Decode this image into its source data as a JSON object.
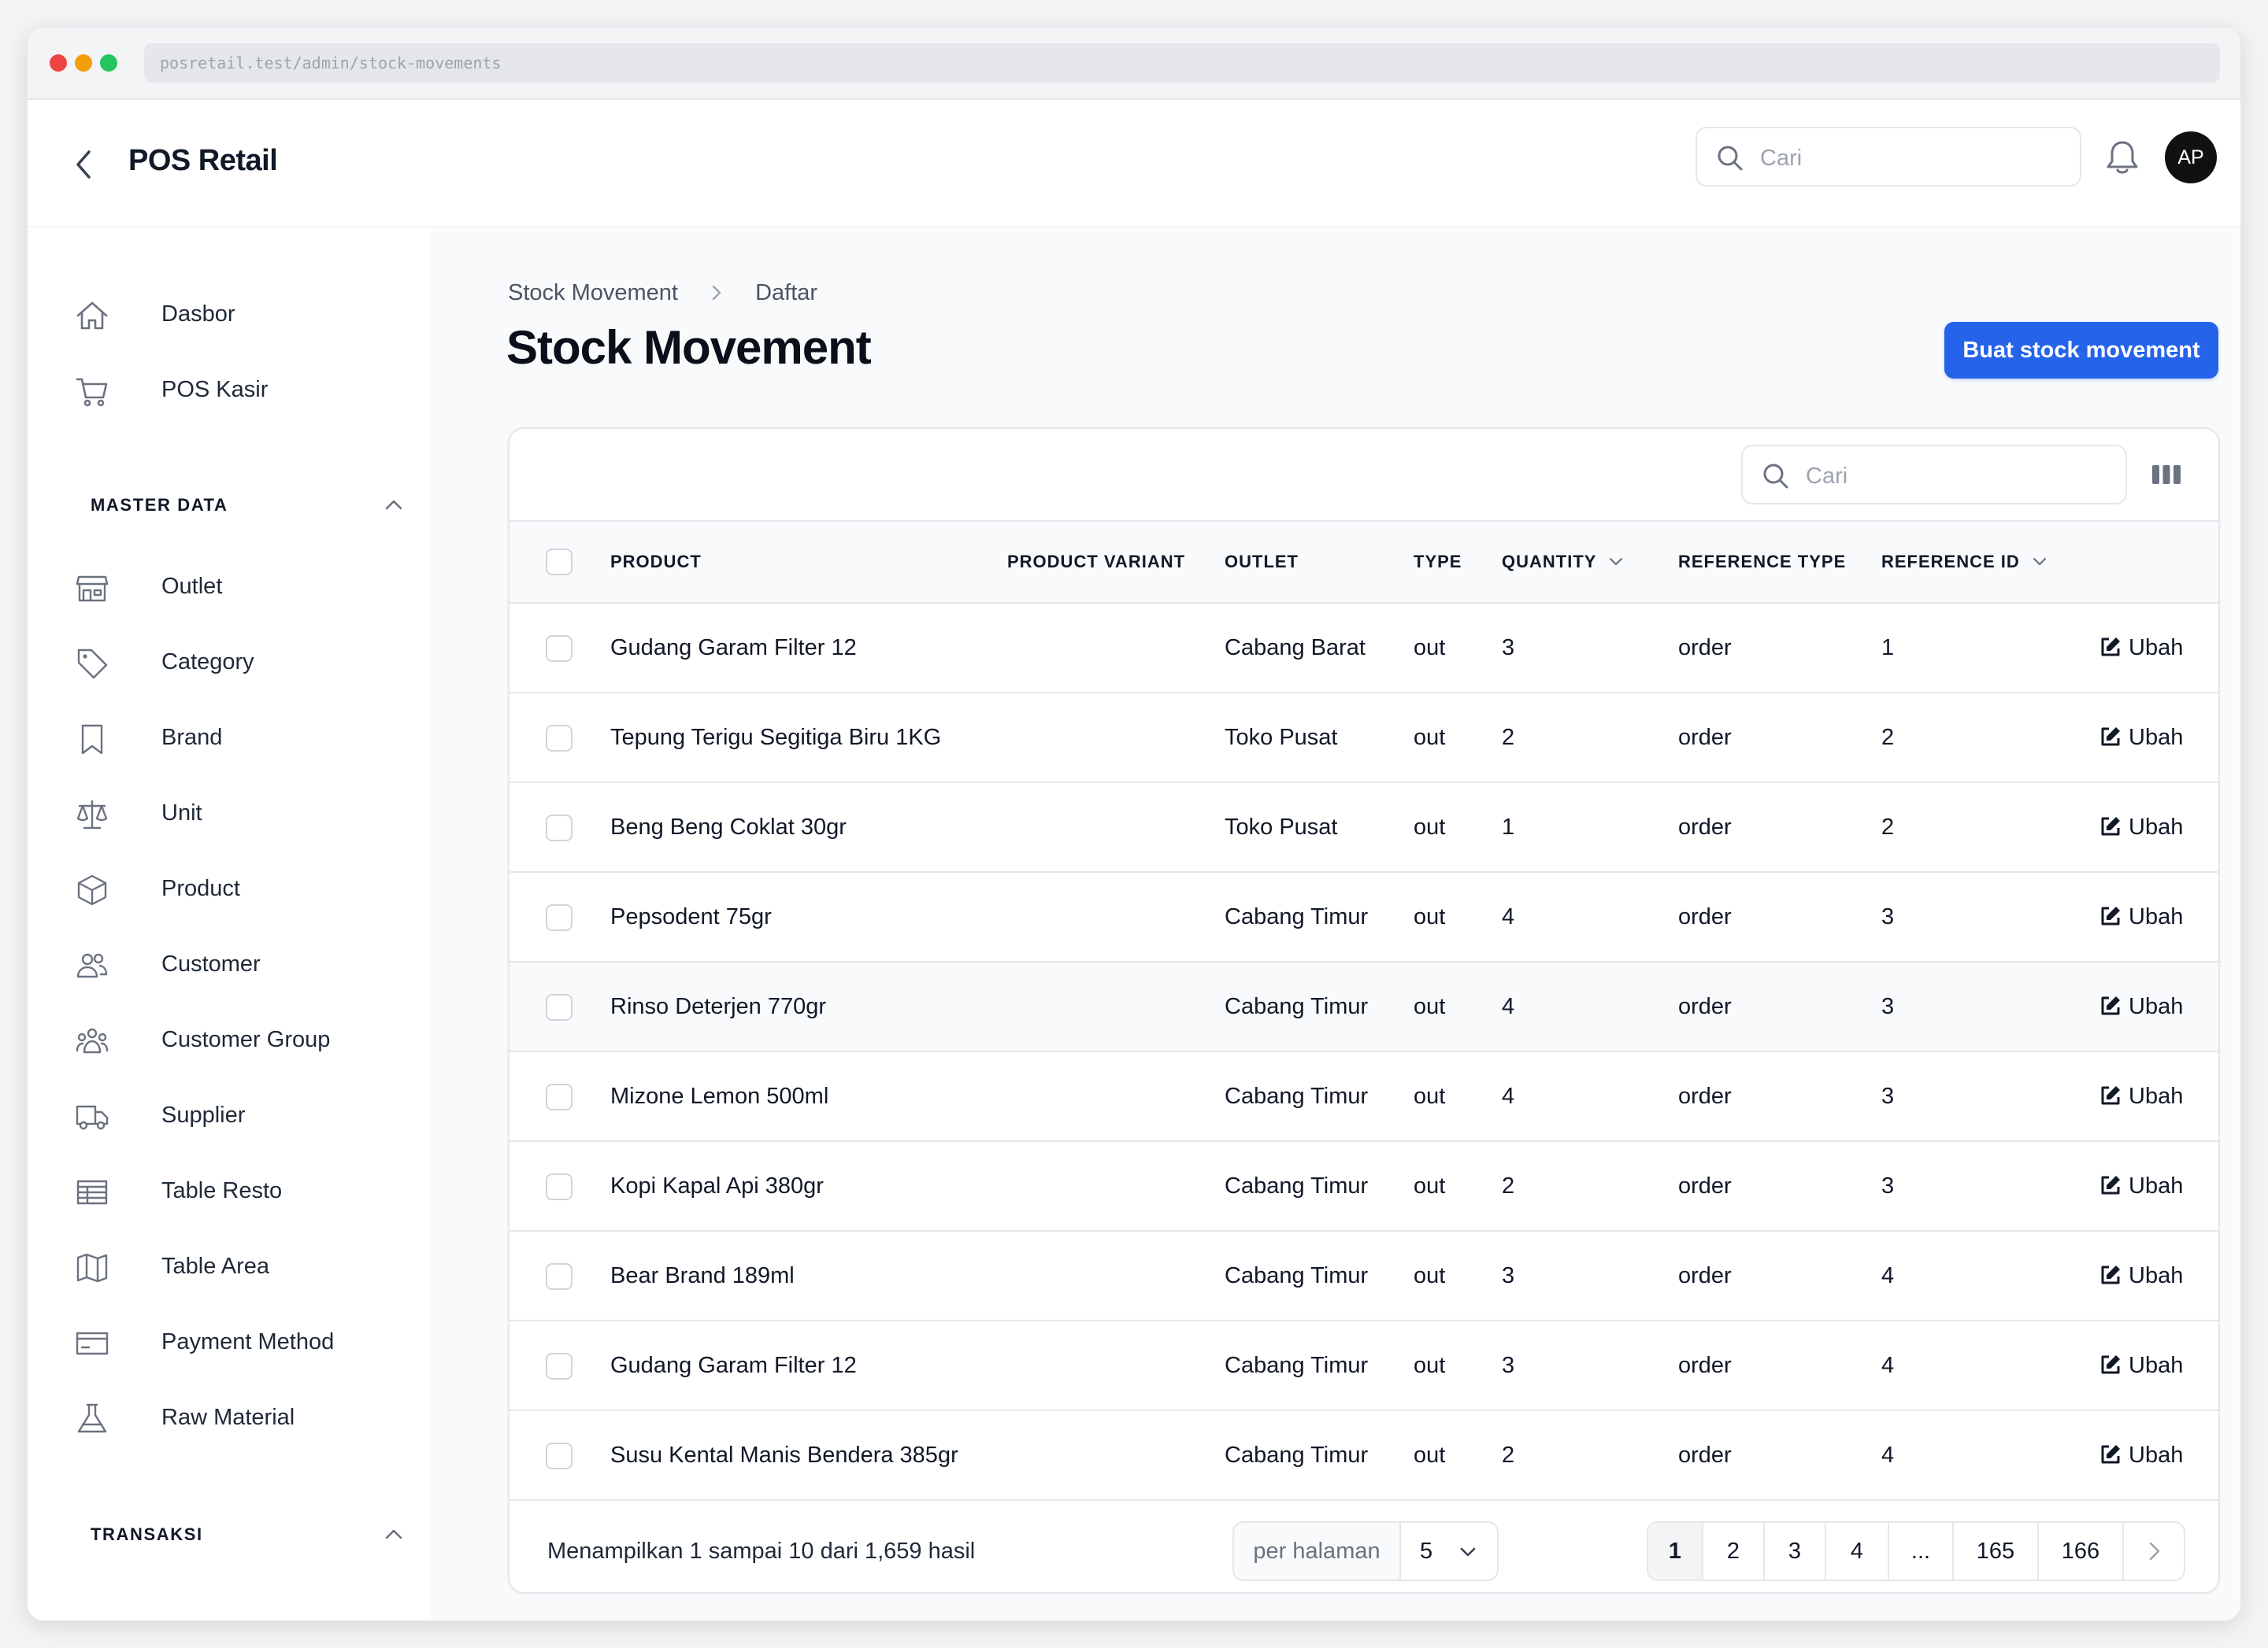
{
  "browser": {
    "url": "posretail.test/admin/stock-movements"
  },
  "topnav": {
    "title": "POS Retail",
    "search_placeholder": "Cari",
    "avatar_initials": "AP"
  },
  "sidebar": {
    "top_items": [
      {
        "label": "Dasbor",
        "icon": "home-icon"
      },
      {
        "label": "POS Kasir",
        "icon": "cart-icon"
      }
    ],
    "groups": [
      {
        "label": "MASTER DATA",
        "items": [
          {
            "label": "Outlet",
            "icon": "store-icon"
          },
          {
            "label": "Category",
            "icon": "tag-icon"
          },
          {
            "label": "Brand",
            "icon": "bookmark-icon"
          },
          {
            "label": "Unit",
            "icon": "scale-icon"
          },
          {
            "label": "Product",
            "icon": "cube-icon"
          },
          {
            "label": "Customer",
            "icon": "users-icon"
          },
          {
            "label": "Customer Group",
            "icon": "user-group-icon"
          },
          {
            "label": "Supplier",
            "icon": "truck-icon"
          },
          {
            "label": "Table Resto",
            "icon": "table-icon"
          },
          {
            "label": "Table Area",
            "icon": "map-icon"
          },
          {
            "label": "Payment Method",
            "icon": "credit-card-icon"
          },
          {
            "label": "Raw Material",
            "icon": "beaker-icon"
          }
        ]
      },
      {
        "label": "TRANSAKSI",
        "items": []
      }
    ]
  },
  "main": {
    "breadcrumb": [
      "Stock Movement",
      "Daftar"
    ],
    "title": "Stock Movement",
    "create_label": "Buat stock movement",
    "table": {
      "search_placeholder": "Cari",
      "columns": [
        "PRODUCT",
        "PRODUCT VARIANT",
        "OUTLET",
        "TYPE",
        "QUANTITY",
        "REFERENCE TYPE",
        "REFERENCE ID"
      ],
      "edit_label": "Ubah",
      "rows": [
        {
          "product": "Gudang Garam Filter 12",
          "variant": "",
          "outlet": "Cabang Barat",
          "type": "out",
          "quantity": "3",
          "reference_type": "order",
          "reference_id": "1"
        },
        {
          "product": "Tepung Terigu Segitiga Biru 1KG",
          "variant": "",
          "outlet": "Toko Pusat",
          "type": "out",
          "quantity": "2",
          "reference_type": "order",
          "reference_id": "2"
        },
        {
          "product": "Beng Beng Coklat 30gr",
          "variant": "",
          "outlet": "Toko Pusat",
          "type": "out",
          "quantity": "1",
          "reference_type": "order",
          "reference_id": "2"
        },
        {
          "product": "Pepsodent 75gr",
          "variant": "",
          "outlet": "Cabang Timur",
          "type": "out",
          "quantity": "4",
          "reference_type": "order",
          "reference_id": "3"
        },
        {
          "product": "Rinso Deterjen 770gr",
          "variant": "",
          "outlet": "Cabang Timur",
          "type": "out",
          "quantity": "4",
          "reference_type": "order",
          "reference_id": "3"
        },
        {
          "product": "Mizone Lemon 500ml",
          "variant": "",
          "outlet": "Cabang Timur",
          "type": "out",
          "quantity": "4",
          "reference_type": "order",
          "reference_id": "3"
        },
        {
          "product": "Kopi Kapal Api 380gr",
          "variant": "",
          "outlet": "Cabang Timur",
          "type": "out",
          "quantity": "2",
          "reference_type": "order",
          "reference_id": "3"
        },
        {
          "product": "Bear Brand 189ml",
          "variant": "",
          "outlet": "Cabang Timur",
          "type": "out",
          "quantity": "3",
          "reference_type": "order",
          "reference_id": "4"
        },
        {
          "product": "Gudang Garam Filter 12",
          "variant": "",
          "outlet": "Cabang Timur",
          "type": "out",
          "quantity": "3",
          "reference_type": "order",
          "reference_id": "4"
        },
        {
          "product": "Susu Kental Manis Bendera 385gr",
          "variant": "",
          "outlet": "Cabang Timur",
          "type": "out",
          "quantity": "2",
          "reference_type": "order",
          "reference_id": "4"
        }
      ]
    },
    "footer": {
      "summary": "Menampilkan 1 sampai 10 dari 1,659 hasil",
      "per_page_label": "per halaman",
      "per_page_value": "5",
      "pages": [
        "1",
        "2",
        "3",
        "4",
        "...",
        "165",
        "166"
      ],
      "active_page": "1"
    }
  },
  "colors": {
    "primary": "#2563eb",
    "sidebar_bg": "#ffffff",
    "main_bg": "#f9fafb"
  }
}
